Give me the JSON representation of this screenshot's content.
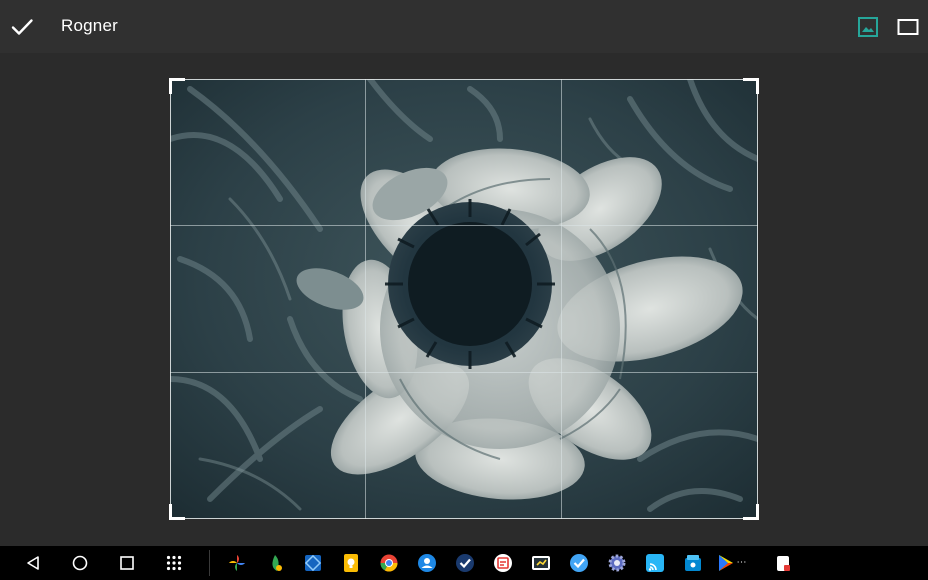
{
  "toolbar": {
    "title": "Rogner",
    "colors": {
      "active": "#26a69a",
      "icon": "#ffffff"
    },
    "left_icon": "check-icon",
    "right_icons": [
      "aspect-free-icon",
      "aspect-rectangle-icon"
    ]
  },
  "crop": {
    "grid": "thirds",
    "handles": [
      "top-left",
      "top-right",
      "bottom-left",
      "bottom-right"
    ]
  },
  "navbar": {
    "buttons": [
      "back-icon",
      "home-icon",
      "recents-icon",
      "app-drawer-icon"
    ]
  },
  "dock": {
    "apps": [
      {
        "name": "google-photos",
        "color": "#fbbc04"
      },
      {
        "name": "snapseed",
        "color": "#34a853"
      },
      {
        "name": "settings-blue",
        "color": "#1e88e5"
      },
      {
        "name": "keep",
        "color": "#fbbc04"
      },
      {
        "name": "chrome",
        "color": "#ea4335"
      },
      {
        "name": "contacts",
        "color": "#1e88e5"
      },
      {
        "name": "tasks",
        "color": "#1a73e8"
      },
      {
        "name": "calendar",
        "color": "#e53935"
      },
      {
        "name": "screenshot",
        "color": "#fdd835"
      },
      {
        "name": "tasks-check",
        "color": "#42a5f5"
      },
      {
        "name": "settings-gear",
        "color": "#5c6bc0"
      },
      {
        "name": "cast",
        "color": "#29b6f6"
      },
      {
        "name": "store",
        "color": "#0288d1"
      },
      {
        "name": "play-store",
        "color": "#00c853"
      },
      {
        "name": "notes-app",
        "color": "#ffffff"
      }
    ]
  }
}
